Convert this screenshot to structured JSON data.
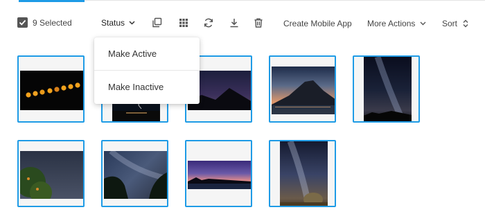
{
  "toolbar": {
    "selected_label": "9 Selected",
    "status_label": "Status",
    "icons": [
      "duplicate-icon",
      "grid-icon",
      "refresh-icon",
      "download-icon",
      "trash-icon"
    ],
    "create_mobile_app_label": "Create Mobile App",
    "more_actions_label": "More Actions",
    "sort_label": "Sort"
  },
  "status_menu": {
    "items": [
      {
        "label": "Make Active"
      },
      {
        "label": "Make Inactive"
      }
    ]
  },
  "gallery": {
    "selected_count": 9,
    "accent_color": "#1e9be6",
    "photos": [
      {
        "subject": "lunar eclipse sequence",
        "selected": true
      },
      {
        "subject": "night lightning over city",
        "selected": true
      },
      {
        "subject": "night sky over hills",
        "selected": true
      },
      {
        "subject": "mountain at dusk over lake",
        "selected": true
      },
      {
        "subject": "milky way vertical",
        "selected": true
      },
      {
        "subject": "starry sky through tree",
        "selected": true
      },
      {
        "subject": "milky way with trees",
        "selected": true
      },
      {
        "subject": "twilight panorama over water",
        "selected": true
      },
      {
        "subject": "milky way over hay bale",
        "selected": true
      }
    ]
  }
}
